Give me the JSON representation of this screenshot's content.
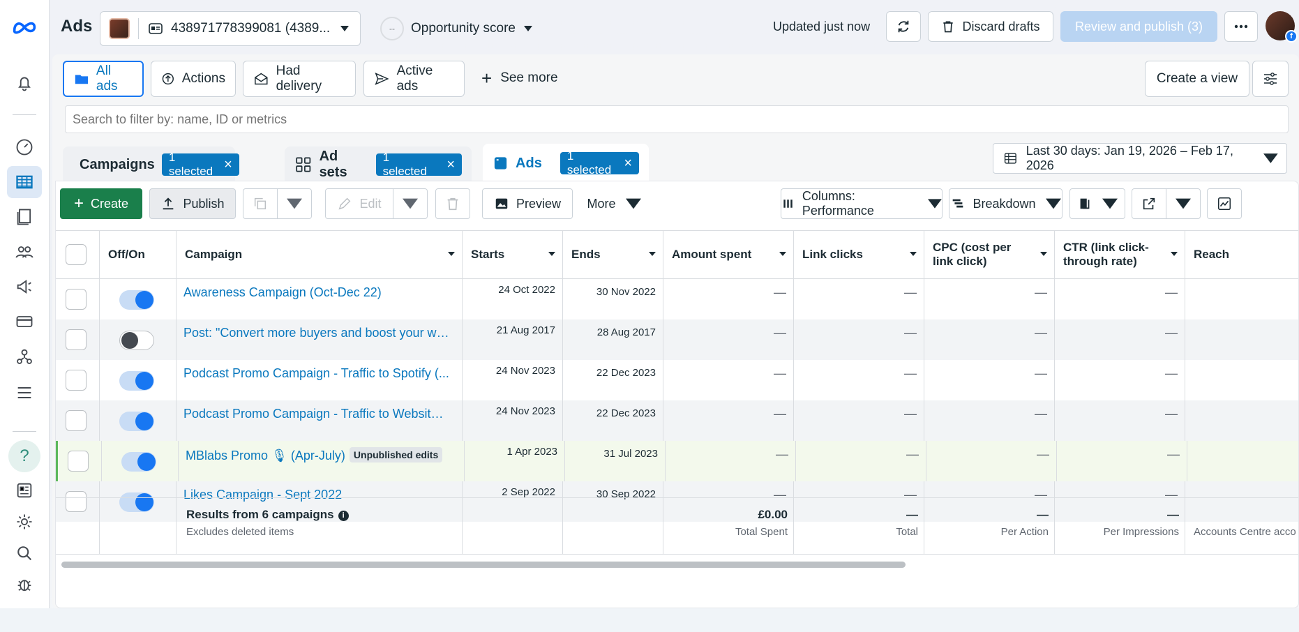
{
  "app": {
    "title": "Ads"
  },
  "account": {
    "name": "438971778399081 (4389..."
  },
  "opportunity": {
    "ring": "--",
    "label": "Opportunity score"
  },
  "status": {
    "updated": "Updated just now"
  },
  "header_buttons": {
    "discard": "Discard drafts",
    "review": "Review and publish (3)"
  },
  "filters": {
    "items": [
      {
        "label": "All ads",
        "icon": "folder-icon"
      },
      {
        "label": "Actions",
        "icon": "upload-circle-icon"
      },
      {
        "label": "Had delivery",
        "icon": "envelope-icon"
      },
      {
        "label": "Active ads",
        "icon": "send-icon"
      }
    ],
    "see_more": "See more",
    "create_view": "Create a view"
  },
  "search": {
    "placeholder": "Search to filter by: name, ID or metrics"
  },
  "levels": [
    {
      "label": "Campaigns",
      "chip": "1 selected"
    },
    {
      "label": "Ad sets",
      "chip": "1 selected"
    },
    {
      "label": "Ads",
      "chip": "1 selected"
    }
  ],
  "date_range": "Last 30 days: Jan 19, 2026 – Feb 17, 2026",
  "toolbar": {
    "create": "Create",
    "publish": "Publish",
    "edit": "Edit",
    "preview": "Preview",
    "more": "More",
    "columns": "Columns: Performance",
    "breakdown": "Breakdown"
  },
  "table": {
    "headers": {
      "onoff": "Off/On",
      "campaign": "Campaign",
      "starts": "Starts",
      "ends": "Ends",
      "spent": "Amount spent",
      "clicks": "Link clicks",
      "cpc": "CPC (cost per link click)",
      "ctr": "CTR (link click-through rate)",
      "reach": "Reach"
    },
    "rows": [
      {
        "name": "Awareness Campaign (Oct-Dec 22)",
        "on": true,
        "badge": "",
        "starts": "24 Oct 2022",
        "ends": "30 Nov 2022",
        "spent": "—",
        "clicks": "—",
        "cpc": "—",
        "ctr": "—"
      },
      {
        "name": "Post: \"Convert more buyers and boost your we...",
        "on": false,
        "badge": "",
        "starts": "21 Aug 2017",
        "ends": "28 Aug 2017",
        "spent": "—",
        "clicks": "—",
        "cpc": "—",
        "ctr": "—"
      },
      {
        "name": "Podcast Promo Campaign - Traffic to Spotify (...",
        "on": true,
        "badge": "",
        "starts": "24 Nov 2023",
        "ends": "22 Dec 2023",
        "spent": "—",
        "clicks": "—",
        "cpc": "—",
        "ctr": "—"
      },
      {
        "name": "Podcast Promo Campaign - Traffic to Website ...",
        "on": true,
        "badge": "",
        "starts": "24 Nov 2023",
        "ends": "22 Dec 2023",
        "spent": "—",
        "clicks": "—",
        "cpc": "—",
        "ctr": "—"
      },
      {
        "name": "MBlabs Promo 🎙 (Apr-July)",
        "on": true,
        "badge": "Unpublished edits",
        "starts": "1 Apr 2023",
        "ends": "31 Jul 2023",
        "spent": "—",
        "clicks": "—",
        "cpc": "—",
        "ctr": "—"
      },
      {
        "name": "Likes Campaign - Sept 2022",
        "on": true,
        "badge": "",
        "starts": "2 Sep 2022",
        "ends": "30 Sep 2022",
        "spent": "—",
        "clicks": "—",
        "cpc": "—",
        "ctr": "—"
      }
    ],
    "footer": {
      "title": "Results from 6 campaigns",
      "subtitle": "Excludes deleted items",
      "spent_value": "£0.00",
      "spent_label": "Total Spent",
      "clicks_value": "—",
      "clicks_label": "Total",
      "cpc_value": "—",
      "cpc_label": "Per Action",
      "ctr_value": "—",
      "ctr_label": "Per Impressions",
      "reach_label": "Accounts Centre acco"
    }
  },
  "colors": {
    "accent": "#0a78be",
    "create": "#1a7f4b",
    "review_disabled": "#b9d4f2"
  }
}
